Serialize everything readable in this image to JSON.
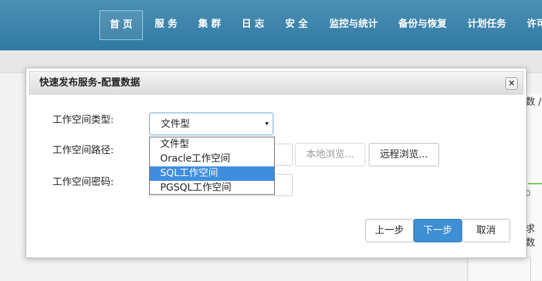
{
  "nav": {
    "items": [
      "首 页",
      "服 务",
      "集 群",
      "日 志",
      "安 全",
      "监控与统计",
      "备份与恢复",
      "计划任务",
      "许可"
    ]
  },
  "background": {
    "partial_text_1": "数 /",
    "partial_text_2": "0",
    "partial_text_3": "求数"
  },
  "dialog": {
    "title": "快速发布服务-配置数据",
    "close_symbol": "×",
    "labels": {
      "workspace_type": "工作空间类型:",
      "workspace_path": "工作空间路径:",
      "workspace_password": "工作空间密码:"
    },
    "workspace_type_select": {
      "value": "文件型",
      "arrow": "▾",
      "options": [
        "文件型",
        "Oracle工作空间",
        "SQL工作空间",
        "PGSQL工作空间"
      ],
      "highlighted": "SQL工作空间"
    },
    "buttons": {
      "local_browse": "本地浏览...",
      "remote_browse": "远程浏览...",
      "prev": "上一步",
      "next": "下一步",
      "cancel": "取消"
    }
  }
}
